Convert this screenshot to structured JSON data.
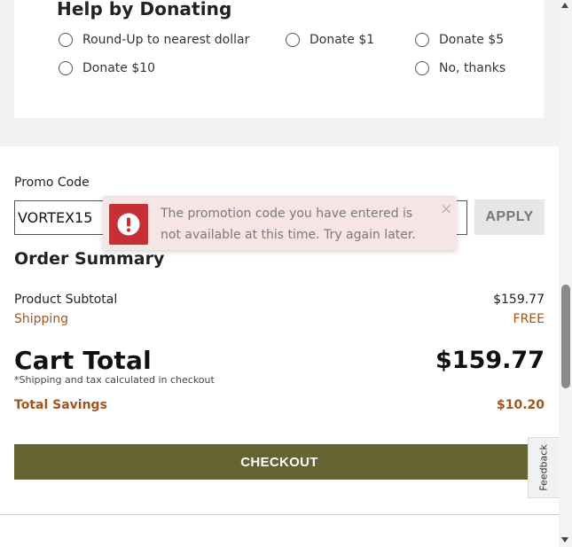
{
  "donation": {
    "title": "Help by Donating",
    "options": [
      {
        "label": "Round-Up to nearest dollar"
      },
      {
        "label": "Donate $1"
      },
      {
        "label": "Donate $5"
      },
      {
        "label": "Donate $10"
      },
      {
        "label": "No, thanks"
      }
    ]
  },
  "promo": {
    "label": "Promo Code",
    "value": "VORTEX15",
    "apply_label": "APPLY"
  },
  "toast": {
    "icon": "exclamation-circle-icon",
    "message": "The promotion code you have entered is not available at this time. Try again later.",
    "close_glyph": "×",
    "color": "#c62f36"
  },
  "summary": {
    "title": "Order Summary",
    "subtotal_label": "Product Subtotal",
    "subtotal_value": "$159.77",
    "shipping_label": "Shipping",
    "shipping_value": "FREE",
    "cart_total_label": "Cart Total",
    "cart_total_value": "$159.77",
    "note": "*Shipping and tax calculated in checkout",
    "savings_label": "Total Savings",
    "savings_value": "$10.20",
    "accent_color": "#a1541c"
  },
  "checkout": {
    "label": "CHECKOUT",
    "color": "#646331"
  },
  "feedback": {
    "label": "Feedback"
  }
}
